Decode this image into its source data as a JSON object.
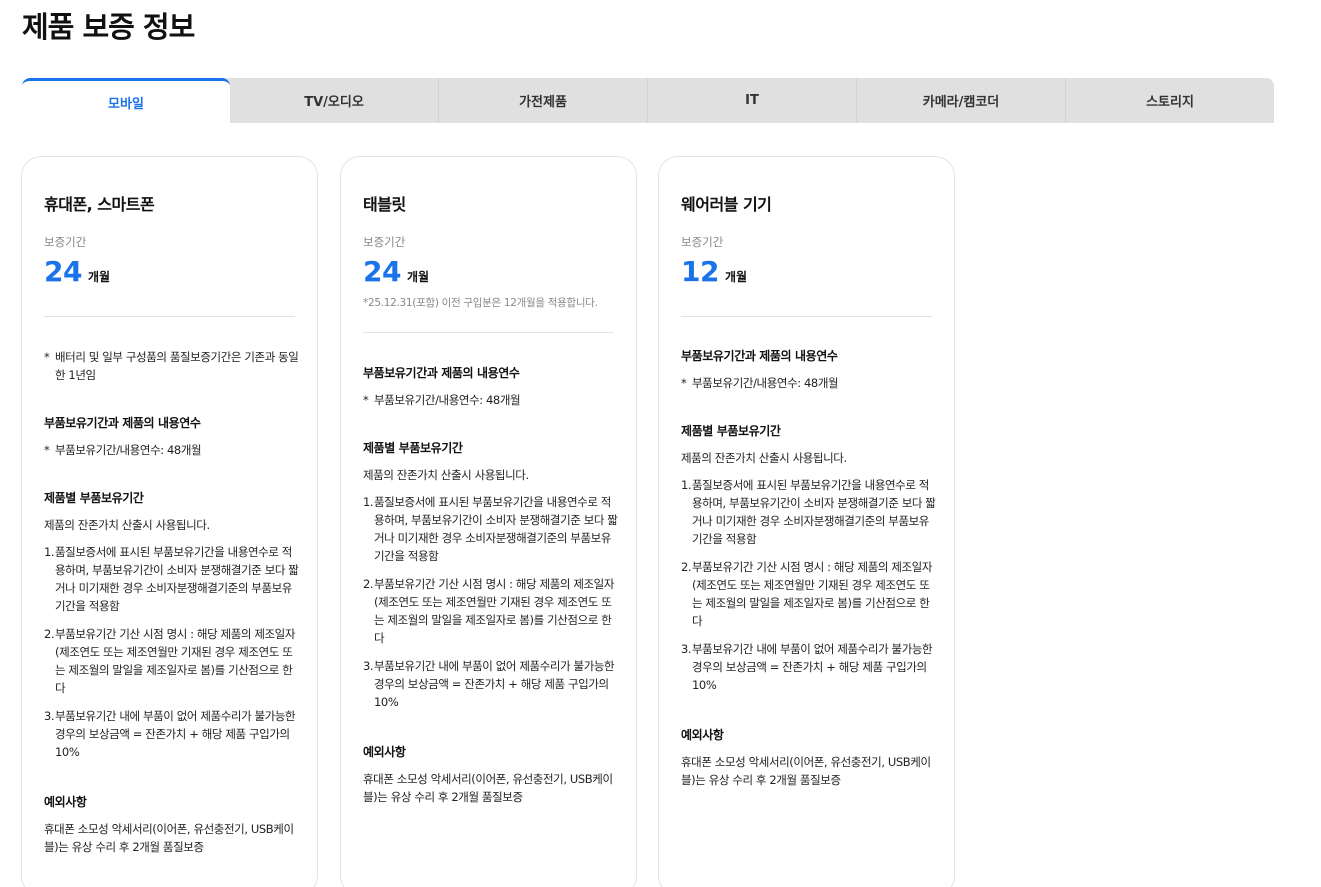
{
  "page_title": "제품 보증 정보",
  "tabs": [
    {
      "label": "모바일",
      "active": true
    },
    {
      "label": "TV/오디오",
      "active": false
    },
    {
      "label": "가전제품",
      "active": false
    },
    {
      "label": "IT",
      "active": false
    },
    {
      "label": "카메라/캠코더",
      "active": false
    },
    {
      "label": "스토리지",
      "active": false
    }
  ],
  "accent_color": "#1a73e8",
  "common": {
    "period_label": "보증기간",
    "period_unit": "개월",
    "parts_section_title": "부품보유기간과 제품의 내용연수",
    "parts_item": "부품보유기간/내용연수: 48개월",
    "residual_section_title": "제품별 부품보유기간",
    "residual_desc": "제품의 잔존가치 산출시 사용됩니다.",
    "rules": [
      {
        "n": "1.",
        "text": "품질보증서에 표시된 부품보유기간을 내용연수로 적용하며, 부품보유기간이 소비자 분쟁해결기준 보다 짧거나 미기재한 경우 소비자분쟁해결기준의 부품보유기간을 적용함"
      },
      {
        "n": "2.",
        "text": "부품보유기간 기산 시점 명시 : 해당 제품의 제조일자(제조연도 또는 제조연월만 기재된 경우 제조연도 또는 제조월의 말일을 제조일자로 봄)를 기산점으로 한다"
      },
      {
        "n": "3.",
        "text": "부품보유기간 내에 부품이 없어 제품수리가 불가능한 경우의 보상금액 = 잔존가치 + 해당 제품 구입가의 10%"
      }
    ],
    "exception_title": "예외사항",
    "exception_text": "휴대폰 소모성 악세서리(이어폰, 유선충전기, USB케이블)는 유상 수리 후 2개월 품질보증"
  },
  "cards": [
    {
      "title": "휴대폰, 스마트폰",
      "period": "24",
      "note": "",
      "battery_note": "배터리 및 일부 구성품의 품질보증기간은 기존과 동일한 1년임"
    },
    {
      "title": "태블릿",
      "period": "24",
      "note": "*25.12.31(포함) 이전 구입분은 12개월을 적용합니다.",
      "battery_note": ""
    },
    {
      "title": "웨어러블 기기",
      "period": "12",
      "note": "",
      "battery_note": ""
    }
  ]
}
